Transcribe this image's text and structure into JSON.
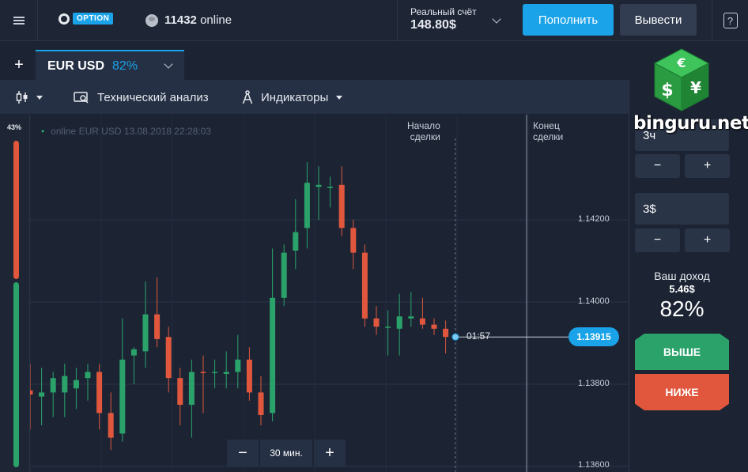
{
  "topbar": {
    "logo_badge": "OPTION",
    "online_count": "11432",
    "online_suffix": "online",
    "account_label": "Реальный счёт",
    "account_balance": "148.80$",
    "deposit_label": "Пополнить",
    "withdraw_label": "Вывести",
    "help_glyph": "?"
  },
  "tabs": [
    {
      "pair": "EUR USD",
      "payout": "82%"
    }
  ],
  "tab_add_label": "+",
  "toolbar": {
    "tech_analysis_label": "Технический анализ",
    "indicators_label": "Индикаторы"
  },
  "chart": {
    "sentiment_pct": "43%",
    "info_line": "online EUR USD  13.08.2018 22:28:03",
    "deal_start_line1": "Начало",
    "deal_start_line2": "сделки",
    "deal_end_line1": "Конец",
    "deal_end_line2": "сделки",
    "timer": "01:57",
    "current_price": "1.13915",
    "price_ticks": [
      "1.14200",
      "1.14000",
      "1.13800",
      "1.13600"
    ],
    "zoom_minus": "−",
    "zoom_value": "30 мин.",
    "zoom_plus": "+"
  },
  "chart_data": {
    "type": "candlestick",
    "title": "",
    "ylabel": "",
    "ylim": [
      1.136,
      1.144
    ],
    "y_ticks": [
      1.142,
      1.14,
      1.138,
      1.136
    ],
    "candles": [
      {
        "o": 1.13785,
        "h": 1.1385,
        "l": 1.1369,
        "c": 1.13775,
        "dir": "down"
      },
      {
        "o": 1.1377,
        "h": 1.1384,
        "l": 1.137,
        "c": 1.1378,
        "dir": "up"
      },
      {
        "o": 1.1378,
        "h": 1.1383,
        "l": 1.1372,
        "c": 1.13815,
        "dir": "up"
      },
      {
        "o": 1.1378,
        "h": 1.1385,
        "l": 1.1372,
        "c": 1.1382,
        "dir": "up"
      },
      {
        "o": 1.1379,
        "h": 1.1384,
        "l": 1.1374,
        "c": 1.1381,
        "dir": "up"
      },
      {
        "o": 1.13815,
        "h": 1.1385,
        "l": 1.1376,
        "c": 1.1383,
        "dir": "up"
      },
      {
        "o": 1.1383,
        "h": 1.1385,
        "l": 1.1369,
        "c": 1.1373,
        "dir": "down"
      },
      {
        "o": 1.1373,
        "h": 1.1378,
        "l": 1.1364,
        "c": 1.1367,
        "dir": "down"
      },
      {
        "o": 1.1368,
        "h": 1.1396,
        "l": 1.1366,
        "c": 1.1386,
        "dir": "up"
      },
      {
        "o": 1.1387,
        "h": 1.1389,
        "l": 1.138,
        "c": 1.13885,
        "dir": "up"
      },
      {
        "o": 1.1388,
        "h": 1.1405,
        "l": 1.1384,
        "c": 1.1397,
        "dir": "up"
      },
      {
        "o": 1.1397,
        "h": 1.1406,
        "l": 1.1389,
        "c": 1.1391,
        "dir": "down"
      },
      {
        "o": 1.13915,
        "h": 1.1394,
        "l": 1.1378,
        "c": 1.13815,
        "dir": "down"
      },
      {
        "o": 1.13815,
        "h": 1.1384,
        "l": 1.137,
        "c": 1.1375,
        "dir": "down"
      },
      {
        "o": 1.1375,
        "h": 1.1386,
        "l": 1.1367,
        "c": 1.1383,
        "dir": "up"
      },
      {
        "o": 1.1383,
        "h": 1.1387,
        "l": 1.1373,
        "c": 1.1383,
        "dir": "down"
      },
      {
        "o": 1.1383,
        "h": 1.1386,
        "l": 1.1379,
        "c": 1.1383,
        "dir": "up"
      },
      {
        "o": 1.13825,
        "h": 1.1388,
        "l": 1.1379,
        "c": 1.1383,
        "dir": "up"
      },
      {
        "o": 1.1383,
        "h": 1.1392,
        "l": 1.1379,
        "c": 1.1386,
        "dir": "up"
      },
      {
        "o": 1.1386,
        "h": 1.1389,
        "l": 1.1376,
        "c": 1.1378,
        "dir": "down"
      },
      {
        "o": 1.1378,
        "h": 1.1382,
        "l": 1.137,
        "c": 1.13725,
        "dir": "down"
      },
      {
        "o": 1.1373,
        "h": 1.1413,
        "l": 1.1371,
        "c": 1.1401,
        "dir": "up"
      },
      {
        "o": 1.1401,
        "h": 1.1414,
        "l": 1.1399,
        "c": 1.1412,
        "dir": "up"
      },
      {
        "o": 1.14125,
        "h": 1.1425,
        "l": 1.1408,
        "c": 1.1417,
        "dir": "up"
      },
      {
        "o": 1.1418,
        "h": 1.1434,
        "l": 1.1413,
        "c": 1.1429,
        "dir": "up"
      },
      {
        "o": 1.14285,
        "h": 1.1433,
        "l": 1.142,
        "c": 1.1428,
        "dir": "up"
      },
      {
        "o": 1.1428,
        "h": 1.14305,
        "l": 1.1423,
        "c": 1.1428,
        "dir": "up"
      },
      {
        "o": 1.14285,
        "h": 1.1433,
        "l": 1.1416,
        "c": 1.1418,
        "dir": "down"
      },
      {
        "o": 1.1418,
        "h": 1.142,
        "l": 1.1408,
        "c": 1.1412,
        "dir": "down"
      },
      {
        "o": 1.1412,
        "h": 1.1414,
        "l": 1.1394,
        "c": 1.1396,
        "dir": "down"
      },
      {
        "o": 1.1396,
        "h": 1.1399,
        "l": 1.1392,
        "c": 1.1394,
        "dir": "down"
      },
      {
        "o": 1.1394,
        "h": 1.1398,
        "l": 1.1387,
        "c": 1.1394,
        "dir": "up"
      },
      {
        "o": 1.13935,
        "h": 1.1402,
        "l": 1.1387,
        "c": 1.13965,
        "dir": "up"
      },
      {
        "o": 1.13965,
        "h": 1.14025,
        "l": 1.1394,
        "c": 1.1396,
        "dir": "up"
      },
      {
        "o": 1.1396,
        "h": 1.1401,
        "l": 1.13935,
        "c": 1.13945,
        "dir": "down"
      },
      {
        "o": 1.13945,
        "h": 1.1396,
        "l": 1.1392,
        "c": 1.13935,
        "dir": "down"
      },
      {
        "o": 1.13935,
        "h": 1.13955,
        "l": 1.13875,
        "c": 1.13915,
        "dir": "down"
      }
    ]
  },
  "panel": {
    "time_value": "3ч",
    "minus": "−",
    "plus": "+",
    "amount_value": "3$",
    "income_label": "Ваш доход",
    "income_value": "5.46$",
    "income_pct": "82%",
    "up_label": "ВЫШЕ",
    "down_label": "НИЖЕ"
  },
  "watermark": {
    "text": "binguru.net",
    "symbols": [
      "€",
      "$",
      "¥"
    ]
  },
  "colors": {
    "accent": "#1aa3e8",
    "up": "#2aa26a",
    "down": "#e0573d",
    "background": "#1c2434"
  }
}
